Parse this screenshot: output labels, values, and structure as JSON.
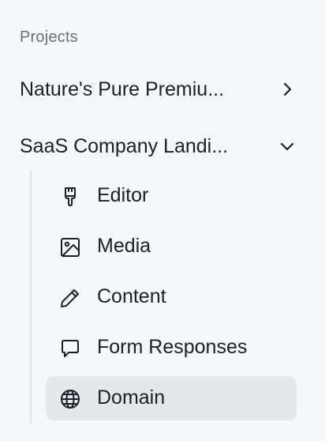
{
  "sidebar": {
    "section_label": "Projects",
    "projects": [
      {
        "label": "Nature's Pure Premiu...",
        "icon": "chevron-right-icon",
        "expanded": false
      },
      {
        "label": "SaaS Company Landi...",
        "icon": "chevron-down-icon",
        "expanded": true
      }
    ],
    "sub_items": [
      {
        "label": "Editor",
        "icon": "paintbrush-icon",
        "active": false
      },
      {
        "label": "Media",
        "icon": "image-icon",
        "active": false
      },
      {
        "label": "Content",
        "icon": "pencil-icon",
        "active": false
      },
      {
        "label": "Form Responses",
        "icon": "message-square-icon",
        "active": false
      },
      {
        "label": "Domain",
        "icon": "globe-icon",
        "active": true
      }
    ]
  }
}
